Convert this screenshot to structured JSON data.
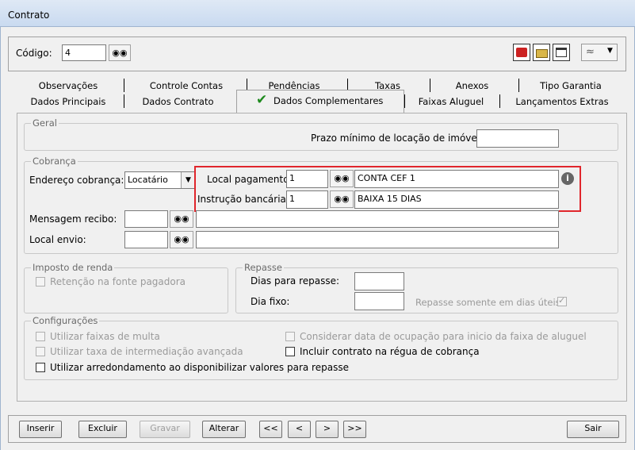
{
  "window": {
    "title": "Contrato"
  },
  "header": {
    "codigo_label": "Código:",
    "codigo_value": "4"
  },
  "tabs_row1": [
    "Observações",
    "Controle Contas",
    "Pendências",
    "Taxas",
    "Anexos",
    "Tipo Garantia"
  ],
  "tabs_row2": [
    "Dados Principais",
    "Dados Contrato",
    "Dados Complementares",
    "Faixas Aluguel",
    "Lançamentos Extras"
  ],
  "active_tab": "Dados Complementares",
  "geral": {
    "legend": "Geral",
    "prazo_label": "Prazo mínimo de locação de imóveis:",
    "prazo_value": ""
  },
  "cobranca": {
    "legend": "Cobrança",
    "endereco_label": "Endereço cobrança:",
    "endereco_value": "Locatário",
    "local_pagamento_label": "Local pagamento:",
    "local_pagamento_code": "1",
    "local_pagamento_desc": "CONTA CEF 1",
    "instrucao_label": "Instrução bancária:",
    "instrucao_code": "1",
    "instrucao_desc": "BAIXA 15 DIAS",
    "mensagem_label": "Mensagem recibo:",
    "mensagem_value": "",
    "local_envio_label": "Local envio:",
    "local_envio_value": ""
  },
  "imposto": {
    "legend": "Imposto de renda",
    "retencao_label": "Retenção na fonte pagadora"
  },
  "repasse": {
    "legend": "Repasse",
    "dias_label": "Dias para repasse:",
    "dia_fixo_label": "Dia fixo:",
    "somente_uteis_label": "Repasse somente em dias úteis"
  },
  "configuracoes": {
    "legend": "Configurações",
    "faixas_multa": "Utilizar faixas de multa",
    "taxa_intermediacao": "Utilizar taxa de intermediação avançada",
    "arredondamento": "Utilizar arredondamento ao disponibilizar valores para repasse",
    "data_ocupacao": "Considerar data de ocupação para inicio da faixa de aluguel",
    "incluir_regua": "Incluir contrato na régua de cobrança"
  },
  "footer": {
    "inserir": "Inserir",
    "excluir": "Excluir",
    "gravar": "Gravar",
    "alterar": "Alterar",
    "first": "<<",
    "prev": "<",
    "next": ">",
    "last": ">>",
    "sair": "Sair"
  },
  "colors": {
    "highlight": "#e0262c",
    "active_check": "#1e8a1e"
  }
}
